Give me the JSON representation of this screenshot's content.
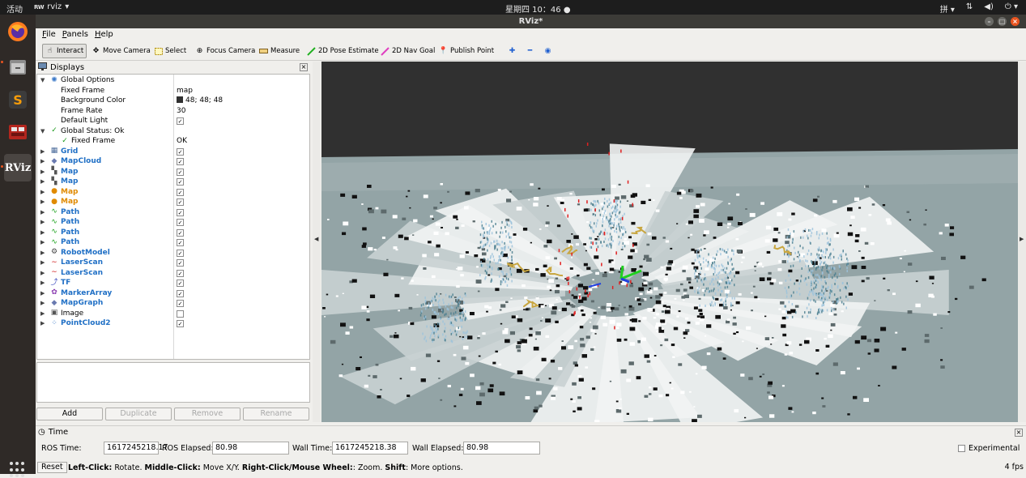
{
  "topbar": {
    "activities": "活动",
    "app_badge": "RW",
    "app_name": "rviz",
    "clock": "星期四 10：46",
    "input_method": "拼",
    "dock_rviz_label": "RViz"
  },
  "window": {
    "title": "RViz*"
  },
  "menu": {
    "file": "File",
    "panels": "Panels",
    "help": "Help"
  },
  "toolbar": {
    "interact": "Interact",
    "move_camera": "Move Camera",
    "select": "Select",
    "focus_camera": "Focus Camera",
    "measure": "Measure",
    "pose_estimate": "2D Pose Estimate",
    "nav_goal": "2D Nav Goal",
    "publish_point": "Publish Point"
  },
  "displays": {
    "title": "Displays",
    "global_options": "Global Options",
    "fixed_frame_label": "Fixed Frame",
    "fixed_frame_value": "map",
    "background_color_label": "Background Color",
    "background_color_value": "48; 48; 48",
    "frame_rate_label": "Frame Rate",
    "frame_rate_value": "30",
    "default_light_label": "Default Light",
    "global_status": "Global Status: Ok",
    "status_fixed_frame": "Fixed Frame",
    "status_fixed_frame_value": "OK",
    "items": [
      {
        "label": "Grid",
        "icon": "grid-icon",
        "checked": true,
        "color": "blue"
      },
      {
        "label": "MapCloud",
        "icon": "diamond-icon",
        "checked": true,
        "color": "blue"
      },
      {
        "label": "Map",
        "icon": "map-icon",
        "checked": true,
        "color": "blue"
      },
      {
        "label": "Map",
        "icon": "map-icon",
        "checked": true,
        "color": "blue"
      },
      {
        "label": "Map",
        "icon": "warning-icon",
        "checked": true,
        "color": "orange"
      },
      {
        "label": "Map",
        "icon": "warning-icon",
        "checked": true,
        "color": "orange"
      },
      {
        "label": "Path",
        "icon": "path-icon",
        "checked": true,
        "color": "blue"
      },
      {
        "label": "Path",
        "icon": "path-icon",
        "checked": true,
        "color": "blue"
      },
      {
        "label": "Path",
        "icon": "path-icon",
        "checked": true,
        "color": "blue"
      },
      {
        "label": "Path",
        "icon": "path-icon",
        "checked": true,
        "color": "blue"
      },
      {
        "label": "RobotModel",
        "icon": "robot-icon",
        "checked": true,
        "color": "blue"
      },
      {
        "label": "LaserScan",
        "icon": "laser-icon",
        "checked": true,
        "color": "blue"
      },
      {
        "label": "LaserScan",
        "icon": "laser-icon",
        "checked": true,
        "color": "blue"
      },
      {
        "label": "TF",
        "icon": "tf-icon",
        "checked": true,
        "color": "blue"
      },
      {
        "label": "MarkerArray",
        "icon": "marker-icon",
        "checked": true,
        "color": "blue"
      },
      {
        "label": "MapGraph",
        "icon": "diamond-icon",
        "checked": true,
        "color": "blue"
      },
      {
        "label": "Image",
        "icon": "image-icon",
        "checked": false,
        "color": "black"
      },
      {
        "label": "PointCloud2",
        "icon": "pointcloud-icon",
        "checked": true,
        "color": "blue"
      }
    ],
    "buttons": {
      "add": "Add",
      "duplicate": "Duplicate",
      "remove": "Remove",
      "rename": "Rename"
    }
  },
  "time": {
    "title": "Time",
    "ros_time_label": "ROS Time:",
    "ros_time": "1617245218.17",
    "ros_elapsed_label": "ROS Elapsed:",
    "ros_elapsed": "80.98",
    "wall_time_label": "Wall Time:",
    "wall_time": "1617245218.38",
    "wall_elapsed_label": "Wall Elapsed:",
    "wall_elapsed": "80.98",
    "experimental": "Experimental"
  },
  "status": {
    "reset": "Reset",
    "hint_left": "Left-Click:",
    "hint_left_text": " Rotate. ",
    "hint_middle": "Middle-Click:",
    "hint_middle_text": " Move X/Y. ",
    "hint_right": "Right-Click/Mouse Wheel:",
    "hint_right_text": ": Zoom. ",
    "hint_shift": "Shift",
    "hint_shift_text": ": More options.",
    "fps": "4 fps"
  },
  "colors": {
    "view_background": "#303030",
    "ubuntu_orange": "#e95420",
    "tree_blue": "#1f6fc5",
    "tree_orange": "#e08a00"
  }
}
